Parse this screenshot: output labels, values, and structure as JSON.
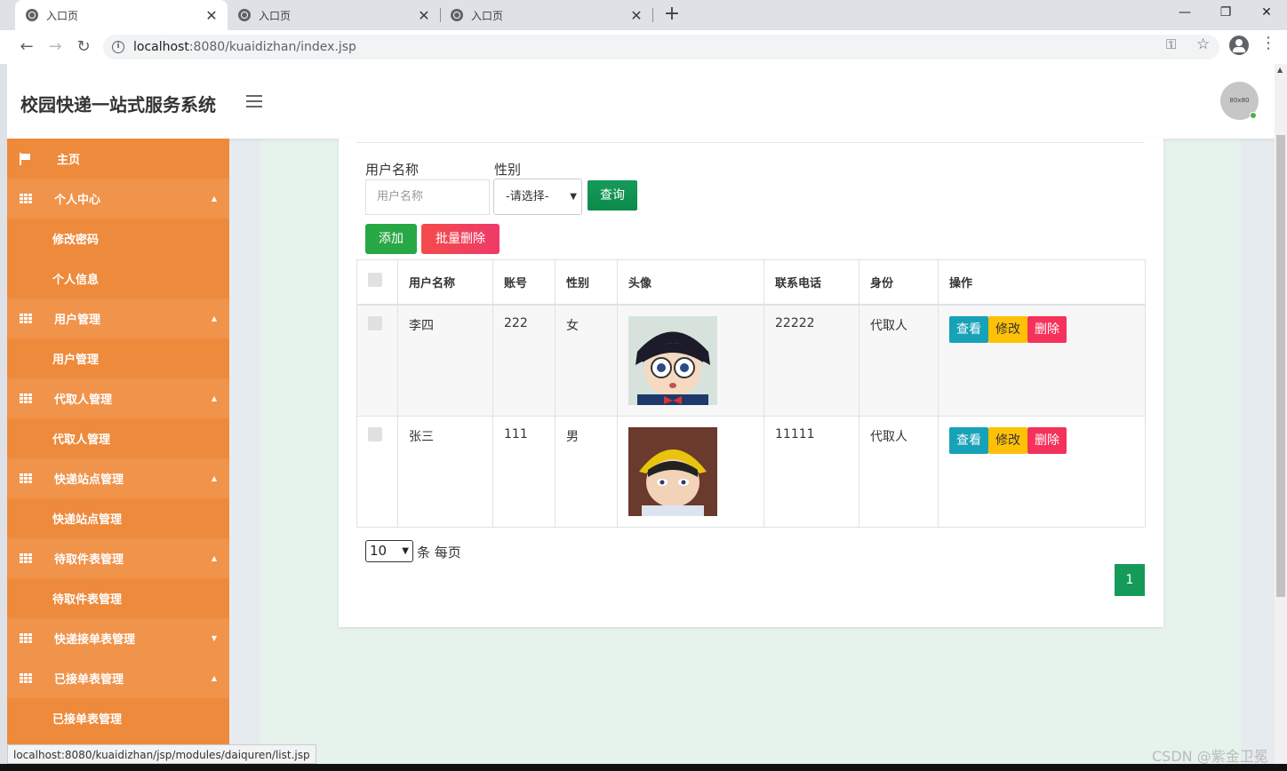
{
  "browser": {
    "tabs": [
      {
        "title": "入口页"
      },
      {
        "title": "入口页"
      },
      {
        "title": "入口页"
      }
    ],
    "url_host": "localhost",
    "url_path": ":8080/kuaidizhan/index.jsp",
    "status_url": "localhost:8080/kuaidizhan/jsp/modules/daiquren/list.jsp"
  },
  "header": {
    "brand": "校园快递一站式服务系统",
    "avatar_text": "80x80"
  },
  "sidebar": {
    "items": [
      {
        "label": "主页",
        "kind": "home"
      },
      {
        "label": "个人中心",
        "kind": "parent",
        "caret": "▲"
      },
      {
        "label": "修改密码",
        "kind": "sub"
      },
      {
        "label": "个人信息",
        "kind": "sub"
      },
      {
        "label": "用户管理",
        "kind": "parent",
        "caret": "▲"
      },
      {
        "label": "用户管理",
        "kind": "sub"
      },
      {
        "label": "代取人管理",
        "kind": "parent",
        "caret": "▲"
      },
      {
        "label": "代取人管理",
        "kind": "sub"
      },
      {
        "label": "快递站点管理",
        "kind": "parent",
        "caret": "▲"
      },
      {
        "label": "快递站点管理",
        "kind": "sub"
      },
      {
        "label": "待取件表管理",
        "kind": "parent",
        "caret": "▲"
      },
      {
        "label": "待取件表管理",
        "kind": "sub"
      },
      {
        "label": "快递接单表管理",
        "kind": "parent",
        "caret": "▼"
      },
      {
        "label": "已接单表管理",
        "kind": "parent",
        "caret": "▲"
      },
      {
        "label": "已接单表管理",
        "kind": "sub"
      }
    ]
  },
  "search": {
    "name_label": "用户名称",
    "name_placeholder": "用户名称",
    "gender_label": "性别",
    "gender_selected": "-请选择-",
    "query_button": "查询",
    "add_button": "添加",
    "batch_delete_button": "批量删除"
  },
  "table": {
    "headers": [
      "用户名称",
      "账号",
      "性别",
      "头像",
      "联系电话",
      "身份",
      "操作"
    ],
    "rows": [
      {
        "name": "李四",
        "account": "222",
        "gender": "女",
        "phone": "22222",
        "role": "代取人"
      },
      {
        "name": "张三",
        "account": "111",
        "gender": "男",
        "phone": "11111",
        "role": "代取人"
      }
    ],
    "actions": {
      "view": "查看",
      "edit": "修改",
      "delete": "删除"
    }
  },
  "pagination": {
    "page_size": "10",
    "per_page_text": "条 每页",
    "current_page": "1"
  },
  "watermark": "CSDN @紫金卫冕",
  "colors": {
    "sidebar": "#ee8a3c",
    "accent_green": "#159a5a",
    "view": "#17a2b8",
    "edit": "#ffc107",
    "delete": "#f5335a"
  }
}
